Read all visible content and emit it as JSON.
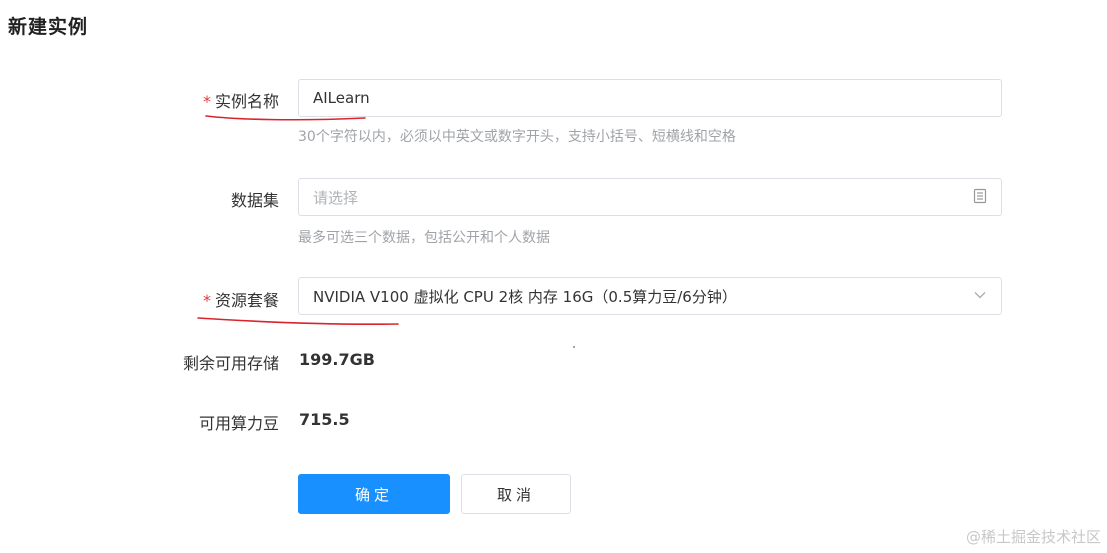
{
  "page": {
    "title": "新建实例"
  },
  "form": {
    "name": {
      "required_mark": "*",
      "label": "实例名称",
      "value": "AILearn",
      "hint": "30个字符以内，必须以中英文或数字开头，支持小括号、短横线和空格"
    },
    "dataset": {
      "label": "数据集",
      "placeholder": "请选择",
      "hint": "最多可选三个数据，包括公开和个人数据",
      "icon": "dataset-icon"
    },
    "resource": {
      "required_mark": "*",
      "label": "资源套餐",
      "value": "NVIDIA V100 虚拟化 CPU 2核 内存 16G（0.5算力豆/6分钟）",
      "icon": "chevron-down-icon"
    },
    "storage": {
      "label": "剩余可用存储",
      "value": "199.7GB"
    },
    "credits": {
      "label": "可用算力豆",
      "value": "715.5"
    }
  },
  "actions": {
    "confirm_label": "确定",
    "cancel_label": "取消"
  },
  "watermark": "@稀土掘金技术社区",
  "colors": {
    "primary": "#1890ff",
    "required": "#e4393c",
    "annotation": "#d9232d"
  }
}
